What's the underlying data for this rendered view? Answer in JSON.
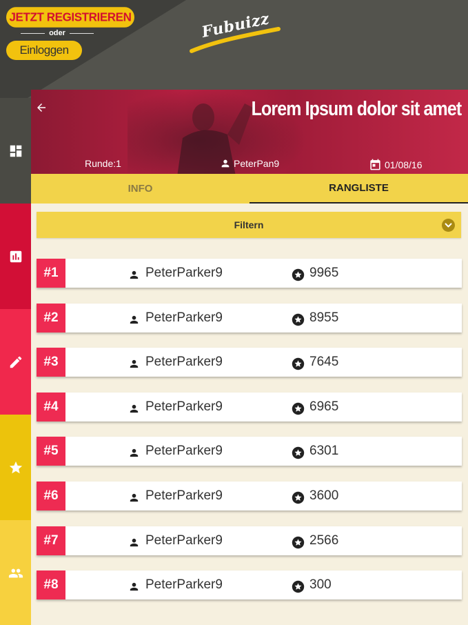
{
  "header": {
    "register_label": "JETZT REGISTRIEREN",
    "or_label": "oder",
    "login_label": "Einloggen",
    "logo_text": "Fubuizz"
  },
  "hero": {
    "title": "Lorem Ipsum dolor sit amet",
    "round": "Runde:1",
    "user": "PeterPan9",
    "date": "01/08/16"
  },
  "tabs": [
    {
      "label": "INFO",
      "active": false
    },
    {
      "label": "RANGLISTE",
      "active": true
    }
  ],
  "filter": {
    "label": "Filtern"
  },
  "sidebar": {
    "items": [
      {
        "icon": "dashboard-icon",
        "color": "#4a4a44"
      },
      {
        "icon": "bar-chart-icon",
        "color": "#d20f36"
      },
      {
        "icon": "pencil-icon",
        "color": "#f0284c"
      },
      {
        "icon": "star-icon",
        "color": "#ecc30c"
      },
      {
        "icon": "group-icon",
        "color": "#f7d13e"
      }
    ]
  },
  "ranking": [
    {
      "rank": "#1",
      "user": "PeterParker9",
      "score": "9965"
    },
    {
      "rank": "#2",
      "user": "PeterParker9",
      "score": "8955"
    },
    {
      "rank": "#3",
      "user": "PeterParker9",
      "score": "7645"
    },
    {
      "rank": "#4",
      "user": "PeterParker9",
      "score": "6965"
    },
    {
      "rank": "#5",
      "user": "PeterParker9",
      "score": "6301"
    },
    {
      "rank": "#6",
      "user": "PeterParker9",
      "score": "3600"
    },
    {
      "rank": "#7",
      "user": "PeterParker9",
      "score": "2566"
    },
    {
      "rank": "#8",
      "user": "PeterParker9",
      "score": "300"
    }
  ],
  "colors": {
    "accent_red": "#ee2b52",
    "accent_yellow": "#f2d34a",
    "header_dark": "#3f3f3b",
    "background": "#f6f0df"
  }
}
